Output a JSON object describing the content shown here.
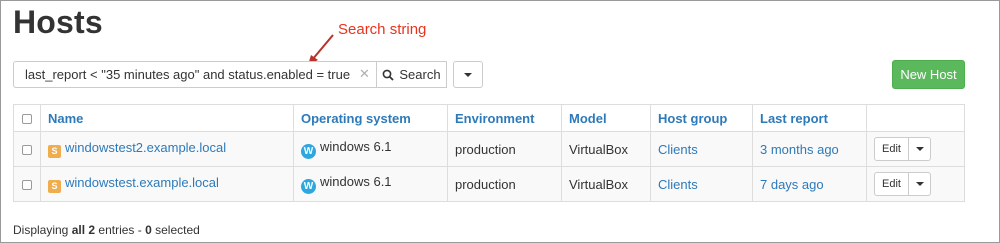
{
  "page": {
    "title": "Hosts"
  },
  "annotation": {
    "label": "Search string",
    "color": "#e8341c"
  },
  "search": {
    "value": "last_report < \"35 minutes ago\" and status.enabled = true",
    "clear_icon": "close-icon",
    "button_label": "Search",
    "button_icon": "search-icon"
  },
  "new_host_label": "New Host",
  "table": {
    "headers": {
      "name": "Name",
      "os": "Operating system",
      "environment": "Environment",
      "model": "Model",
      "hostgroup": "Host group",
      "last_report": "Last report"
    },
    "rows": [
      {
        "badge": "S",
        "name": "windowstest2.example.local",
        "os_icon": "W",
        "os": "windows 6.1",
        "environment": "production",
        "model": "VirtualBox",
        "hostgroup": "Clients",
        "last_report": "3 months ago",
        "action": "Edit"
      },
      {
        "badge": "S",
        "name": "windowstest.example.local",
        "os_icon": "W",
        "os": "windows 6.1",
        "environment": "production",
        "model": "VirtualBox",
        "hostgroup": "Clients",
        "last_report": "7 days ago",
        "action": "Edit"
      }
    ]
  },
  "footer": {
    "prefix": "Displaying ",
    "count_text": "all 2",
    "middle": " entries - ",
    "selected_count": "0",
    "suffix": " selected"
  },
  "colors": {
    "link": "#2e7ab9",
    "success": "#5cb85c",
    "badge": "#f0ad4e",
    "os_icon": "#2ea7de"
  }
}
